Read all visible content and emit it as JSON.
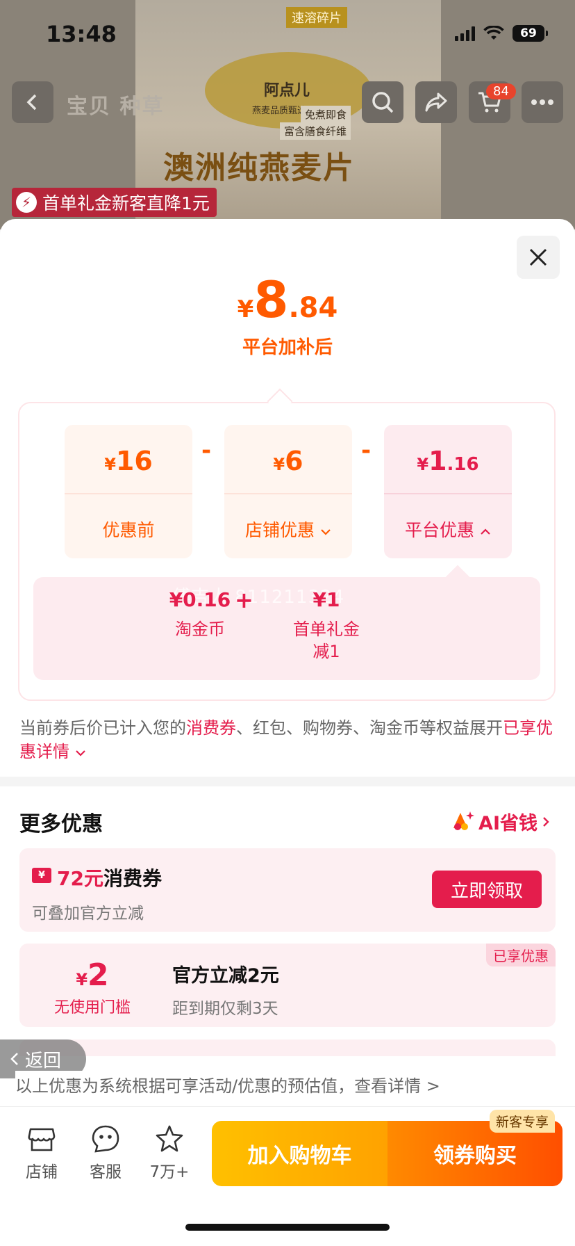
{
  "status_bar": {
    "time": "13:48",
    "battery": "69"
  },
  "background": {
    "nav_tabs": "宝贝  种草",
    "cart_count": "84",
    "product_tag_top": "速溶碎片",
    "product_brand": "阿点儿",
    "product_brand_sub": "燕麦品质甄选",
    "product_tag_2": "免煮即食",
    "product_tag_3": "富含膳食纤维",
    "product_big_title": "澳洲纯燕麦片",
    "promo_ribbon": "首单礼金新客直降1元"
  },
  "sheet": {
    "final_price": {
      "currency": "¥",
      "integer": "8",
      "decimal": ".84"
    },
    "final_caption": "平台加补后",
    "breakdown": {
      "cards": [
        {
          "currency": "¥",
          "integer": "16",
          "decimal": "",
          "label": "优惠前"
        },
        {
          "currency": "¥",
          "integer": "6",
          "decimal": "",
          "label": "店铺优惠"
        },
        {
          "currency": "¥",
          "integer": "1",
          "decimal": ".16",
          "label": "平台优惠"
        }
      ],
      "operators": [
        "-",
        "-"
      ],
      "platform_detail": {
        "watermark": "傅吉人 811211324",
        "items": [
          {
            "value": "¥0.16",
            "label": "淘金币"
          },
          {
            "value": "¥1",
            "label": "首单礼金\n减1"
          }
        ],
        "plus": "+"
      }
    },
    "note": {
      "prefix": "当前券后价已计入您的",
      "highlight1": "消费券",
      "middle": "、红包、购物券、淘金币等权益展开",
      "highlight2": "已享优惠详情"
    },
    "more": {
      "title": "更多优惠",
      "ai_link": "AI省钱",
      "coupon1": {
        "ticket": "¥",
        "amount": "72元",
        "name": "消费券",
        "sub": "可叠加官方立减",
        "button": "立即领取"
      },
      "coupon2": {
        "badge": "已享优惠",
        "currency": "¥",
        "amount": "2",
        "condition": "无使用门槛",
        "title": "官方立减2元",
        "sub": "距到期仅剩3天"
      }
    },
    "return_label": "返回",
    "disclaimer": "以上优惠为系统根据可享活动/优惠的预估值，查看详情 >"
  },
  "bottom_bar": {
    "shop": "店铺",
    "service": "客服",
    "favorites": "7万+",
    "add_to_cart": "加入购物车",
    "buy_now": "领券购买",
    "new_badge": "新客专享"
  },
  "colors": {
    "accent_orange": "#ff5a00",
    "accent_red": "#e41d4c"
  }
}
